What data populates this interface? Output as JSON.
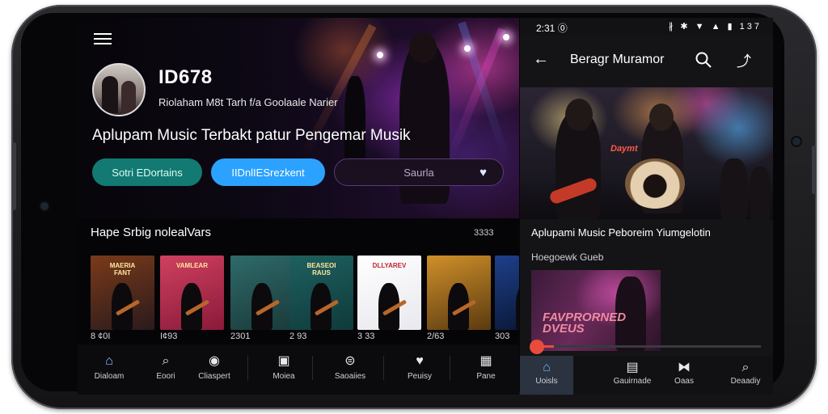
{
  "left": {
    "profile_id": "ID678",
    "subtitle": "Riolaham M8t Tarh f/a Goolaale  Narier",
    "tagline": "Aplupam Music Terbakt patur Pengemar Musik",
    "buttons": [
      "Sotri EDortains",
      "IIDnlIESrezkent",
      "Saurla"
    ],
    "section_title": "Hape Srbig nolealVars",
    "section_count": "3333",
    "albums": [
      {
        "caption": "8 ¢0I",
        "title": "MAERIA\nFANT",
        "colors": [
          "#2a1a1c",
          "#7a3a1a"
        ]
      },
      {
        "caption": "I¢93",
        "title": "VAMLEAR",
        "colors": [
          "#8a1a3a",
          "#d04060"
        ]
      },
      {
        "caption": "2301",
        "title": "",
        "colors": [
          "#1a3a3a",
          "#2f6a6a"
        ]
      },
      {
        "caption": "2 93",
        "title": "BEASEOI\nRAUS",
        "colors": [
          "#0f3a3a",
          "#1f6060"
        ]
      },
      {
        "caption": "3 33",
        "title": "DLLYAREV",
        "colors": [
          "#e8e8ee",
          "#ffffff"
        ]
      },
      {
        "caption": "2/63",
        "title": "",
        "colors": [
          "#5a3a10",
          "#d0902a"
        ]
      },
      {
        "caption": "303",
        "title": "",
        "colors": [
          "#0a1a3a",
          "#1f3f8a"
        ]
      }
    ],
    "nav": [
      {
        "label": "Dialoam",
        "icon": "home-icon",
        "glyph": "⌂"
      },
      {
        "label": "Eoori",
        "icon": "search-icon",
        "glyph": "⌕"
      },
      {
        "label": "Cliaspert",
        "icon": "badge-icon",
        "glyph": "◉"
      },
      {
        "label": "Moiea",
        "icon": "collection-icon",
        "glyph": "▣"
      },
      {
        "label": "Saoaiies",
        "icon": "controller-icon",
        "glyph": "⊜"
      },
      {
        "label": "Peuisy",
        "icon": "heart-icon",
        "glyph": "♥"
      },
      {
        "label": "Pane",
        "icon": "grid-icon",
        "glyph": "▦"
      }
    ]
  },
  "right": {
    "status_time": "2:31 ⓪",
    "status_icons": "∦ ✱ ▼ ▲ ▮ 137",
    "title": "Beragr Muramor",
    "heading": "Aplupami Music Peboreim Yiumgelotin",
    "sub": "Hoegoewk Gueb",
    "card_text": "FAVPRORNED\nDVEUS",
    "drum_label": "Daymt",
    "progress": 0.1,
    "nav": [
      {
        "label": "Uoisls",
        "icon": "home-icon",
        "glyph": "⌂",
        "active": true
      },
      {
        "label": "Gauirnade",
        "icon": "calendar-icon",
        "glyph": "▤",
        "active": false
      },
      {
        "label": "Oaas",
        "icon": "bookmark-icon",
        "glyph": "⧓",
        "active": false
      },
      {
        "label": "Deaadiy",
        "icon": "search-icon",
        "glyph": "⌕",
        "active": false
      }
    ]
  },
  "colors": {
    "accent_teal": "#127a72",
    "accent_blue": "#2ba2ff",
    "accent_red": "#e84c3d",
    "accent_purple": "#5b3a78"
  }
}
